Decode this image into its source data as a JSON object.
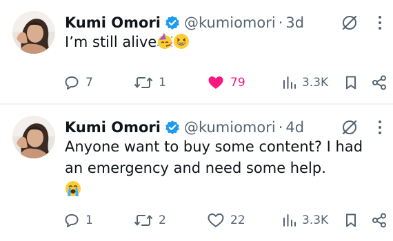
{
  "tweets": [
    {
      "author_name": "Kumi Omori",
      "handle": "@kumiomori",
      "separator": "·",
      "time": "3d",
      "text": "I’m still alive",
      "text_emojis": [
        "partying-face-emoji",
        "grinning-squinting-face-emoji"
      ],
      "replies": "7",
      "reposts": "1",
      "likes": "79",
      "liked": true,
      "views": "3.3K"
    },
    {
      "author_name": "Kumi Omori",
      "handle": "@kumiomori",
      "separator": "·",
      "time": "4d",
      "text": "Anyone want to buy some content? I had an emergency and need some help.",
      "text_emojis": [
        "loudly-crying-face-emoji"
      ],
      "replies": "1",
      "reposts": "2",
      "likes": "22",
      "liked": false,
      "views": "3.3K"
    }
  ],
  "colors": {
    "text": "#0f1419",
    "secondary": "#536471",
    "verified": "#1d9bf0",
    "like": "#f91880",
    "divider": "#eff3f4"
  }
}
